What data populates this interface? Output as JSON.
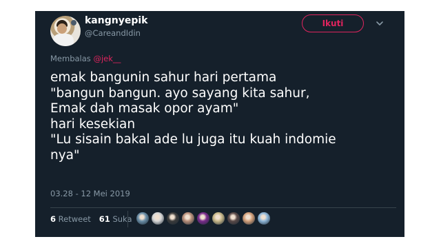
{
  "tweet": {
    "author": {
      "name": "kangnyepik",
      "handle": "@CareandIdin",
      "avatar_icon": "avatar-photo-man-white-shirt"
    },
    "follow_label": "Ikuti",
    "reply": {
      "prefix": "Membalas",
      "mention": "@jek__"
    },
    "text_lines": [
      "emak bangunin sahur hari pertama",
      "\"bangun bangun. ayo sayang kita sahur,",
      "Emak dah masak opor ayam\"",
      "hari kesekian",
      "\"Lu sisain bakal ade lu juga itu kuah indomie",
      "nya\""
    ],
    "timestamp": "03.28 - 12 Mei 2019",
    "stats": {
      "retweets_count": "6",
      "retweets_label": "Retweet",
      "likes_count": "61",
      "likes_label": "Suka"
    },
    "likers": [
      {
        "icon": "liker-avatar-1",
        "color": "#6b8fa8"
      },
      {
        "icon": "liker-avatar-2",
        "color": "#d9d9d9"
      },
      {
        "icon": "liker-avatar-3",
        "color": "#3b3b3b"
      },
      {
        "icon": "liker-avatar-4",
        "color": "#b98f7a"
      },
      {
        "icon": "liker-avatar-5",
        "color": "#7a2b8c"
      },
      {
        "icon": "liker-avatar-6",
        "color": "#c9b98a"
      },
      {
        "icon": "liker-avatar-7",
        "color": "#5a4a48"
      },
      {
        "icon": "liker-avatar-8",
        "color": "#d4a07a"
      },
      {
        "icon": "liker-avatar-9",
        "color": "#8fb7d9"
      }
    ]
  },
  "colors": {
    "background": "#15202b",
    "text": "#ffffff",
    "muted": "#8899a6",
    "accent": "#e0245e"
  }
}
